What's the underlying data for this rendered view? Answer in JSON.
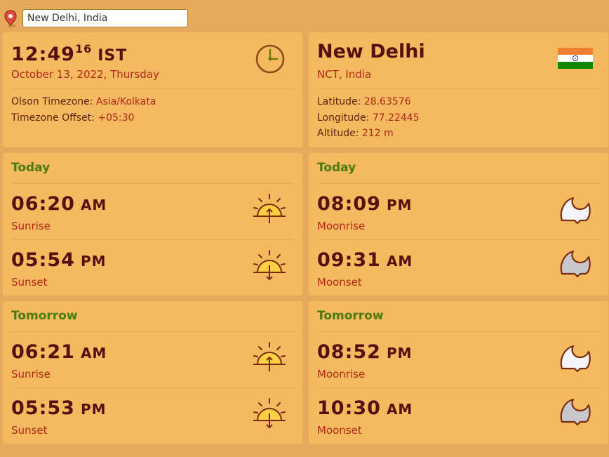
{
  "search": {
    "value": "New Delhi, India"
  },
  "clock_card": {
    "time": "12:49",
    "seconds": "16",
    "zone": "IST",
    "date": "October 13, 2022, Thursday",
    "olson_label": "Olson Timezone:",
    "olson_value": "Asia/Kolkata",
    "offset_label": "Timezone Offset:",
    "offset_value": "+05:30"
  },
  "location_card": {
    "city": "New Delhi",
    "region": "NCT, India",
    "latitude_label": "Latitude:",
    "latitude_value": "28.63576",
    "longitude_label": "Longitude:",
    "longitude_value": "77.22445",
    "altitude_label": "Altitude:",
    "altitude_value": "212 m"
  },
  "sun_today": {
    "heading": "Today",
    "rise_time": "06:20",
    "rise_ampm": "AM",
    "rise_label": "Sunrise",
    "set_time": "05:54",
    "set_ampm": "PM",
    "set_label": "Sunset"
  },
  "moon_today": {
    "heading": "Today",
    "rise_time": "08:09",
    "rise_ampm": "PM",
    "rise_label": "Moonrise",
    "set_time": "09:31",
    "set_ampm": "AM",
    "set_label": "Moonset"
  },
  "sun_tomorrow": {
    "heading": "Tomorrow",
    "rise_time": "06:21",
    "rise_ampm": "AM",
    "rise_label": "Sunrise",
    "set_time": "05:53",
    "set_ampm": "PM",
    "set_label": "Sunset"
  },
  "moon_tomorrow": {
    "heading": "Tomorrow",
    "rise_time": "08:52",
    "rise_ampm": "PM",
    "rise_label": "Moonrise",
    "set_time": "10:30",
    "set_ampm": "AM",
    "set_label": "Moonset"
  },
  "colors": {
    "background": "#e8a95c",
    "card": "#f5b95f",
    "heading_green": "#4a7a10",
    "time_dark": "#5a0e0e",
    "accent_red": "#b0281a"
  },
  "icons": [
    "map-pin-icon",
    "clock-icon",
    "india-flag-icon",
    "sunrise-icon",
    "sunset-icon",
    "moonrise-icon",
    "moonset-icon"
  ]
}
